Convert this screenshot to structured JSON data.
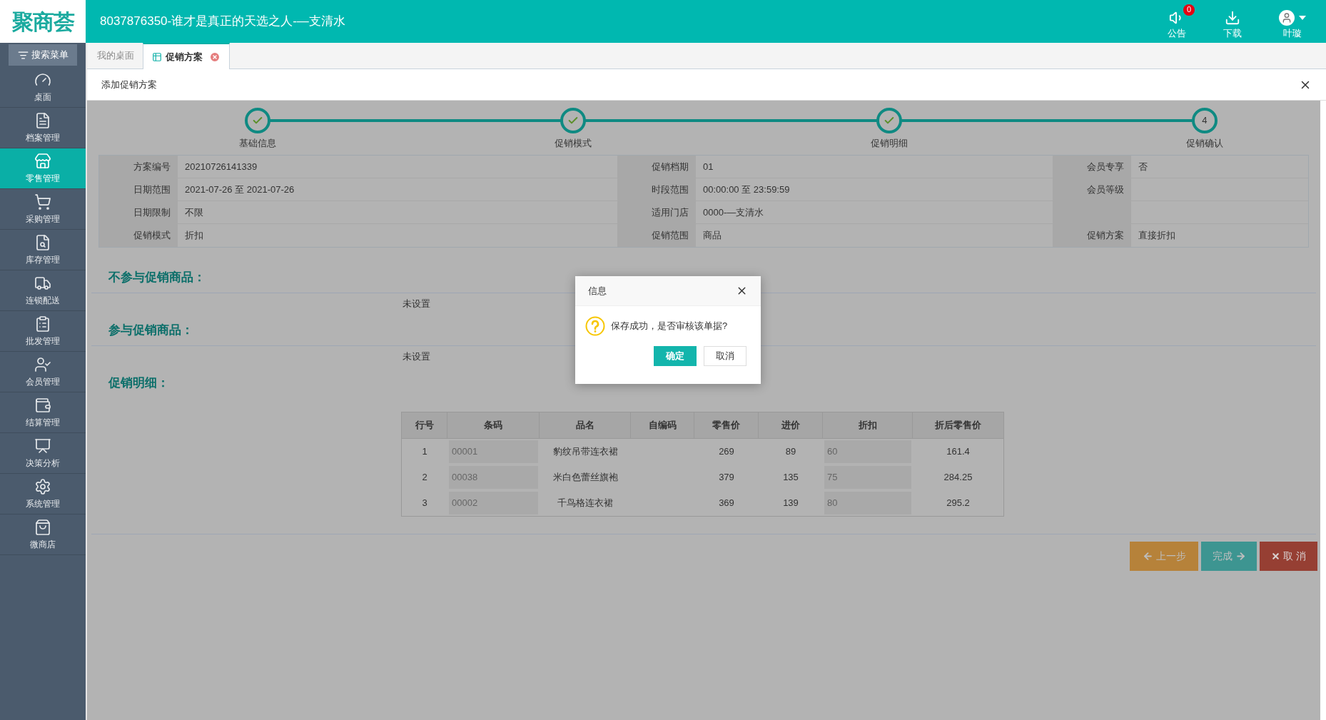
{
  "header": {
    "logo": "聚商荟",
    "title": "8037876350-谁才是真正的天选之人-—支清水",
    "actions": [
      {
        "kind": "notice",
        "label": "公告",
        "badge": "0"
      },
      {
        "kind": "download",
        "label": "下载"
      },
      {
        "kind": "user",
        "label": "叶璇"
      }
    ]
  },
  "sidebar": {
    "search_button": "搜索菜单",
    "items": [
      {
        "label": "桌面",
        "selected": false
      },
      {
        "label": "档案管理",
        "selected": false
      },
      {
        "label": "零售管理",
        "selected": true
      },
      {
        "label": "采购管理",
        "selected": false
      },
      {
        "label": "库存管理",
        "selected": false
      },
      {
        "label": "连锁配送",
        "selected": false
      },
      {
        "label": "批发管理",
        "selected": false
      },
      {
        "label": "会员管理",
        "selected": false
      },
      {
        "label": "结算管理",
        "selected": false
      },
      {
        "label": "决策分析",
        "selected": false
      },
      {
        "label": "系统管理",
        "selected": false
      },
      {
        "label": "微商店",
        "selected": false
      }
    ]
  },
  "tabs": [
    {
      "label": "我的桌面",
      "selected": false,
      "closable": false
    },
    {
      "label": "促销方案",
      "selected": true,
      "closable": true
    }
  ],
  "panel": {
    "title": "添加促销方案"
  },
  "steps": [
    {
      "label": "基础信息",
      "done": true
    },
    {
      "label": "促销模式",
      "done": true
    },
    {
      "label": "促销明细",
      "done": true
    },
    {
      "label": "促销确认",
      "done": false,
      "number": "4"
    }
  ],
  "info": [
    [
      {
        "label": "方案编号",
        "value": "20210726141339"
      },
      {
        "label": "促销档期",
        "value": "01"
      },
      {
        "label": "会员专享",
        "value": "否"
      }
    ],
    [
      {
        "label": "日期范围",
        "value": "2021-07-26 至 2021-07-26"
      },
      {
        "label": "时段范围",
        "value": "00:00:00 至 23:59:59"
      },
      {
        "label": "会员等级"
      }
    ],
    [
      {
        "label": "日期限制",
        "value": "不限"
      },
      {
        "label": "适用门店",
        "value": "0000-—支清水"
      }
    ],
    [
      {
        "label": "促销模式",
        "value": "折扣"
      },
      {
        "label": "促销范围",
        "value": "商品"
      },
      {
        "label": "促销方案",
        "value": "直接折扣"
      }
    ]
  ],
  "sections": [
    {
      "title": "不参与促销商品：",
      "text": "未设置"
    },
    {
      "title": "参与促销商品：",
      "text": "未设置"
    }
  ],
  "detail_title": "促销明细：",
  "table": {
    "columns": [
      "行号",
      "条码",
      "品名",
      "自编码",
      "零售价",
      "进价",
      "折扣",
      "折后零售价"
    ],
    "rows": [
      [
        "1",
        "00001",
        "豹纹吊带连衣裙",
        "",
        "269",
        "89",
        "60",
        "161.4"
      ],
      [
        "2",
        "00038",
        "米白色蕾丝旗袍",
        "",
        "379",
        "135",
        "75",
        "284.25"
      ],
      [
        "3",
        "00002",
        "千鸟格连衣裙",
        "",
        "369",
        "139",
        "80",
        "295.2"
      ]
    ]
  },
  "buttons": [
    {
      "kind": "prev",
      "label": "上一步"
    },
    {
      "kind": "finish",
      "label": "完成"
    },
    {
      "kind": "cancel",
      "label": "取 消"
    }
  ],
  "dialog": {
    "title": "信息",
    "message": "保存成功，是否审核该单据?",
    "buttons": [
      {
        "label": "确定",
        "primary": true
      },
      {
        "label": "取消",
        "primary": false
      }
    ]
  }
}
